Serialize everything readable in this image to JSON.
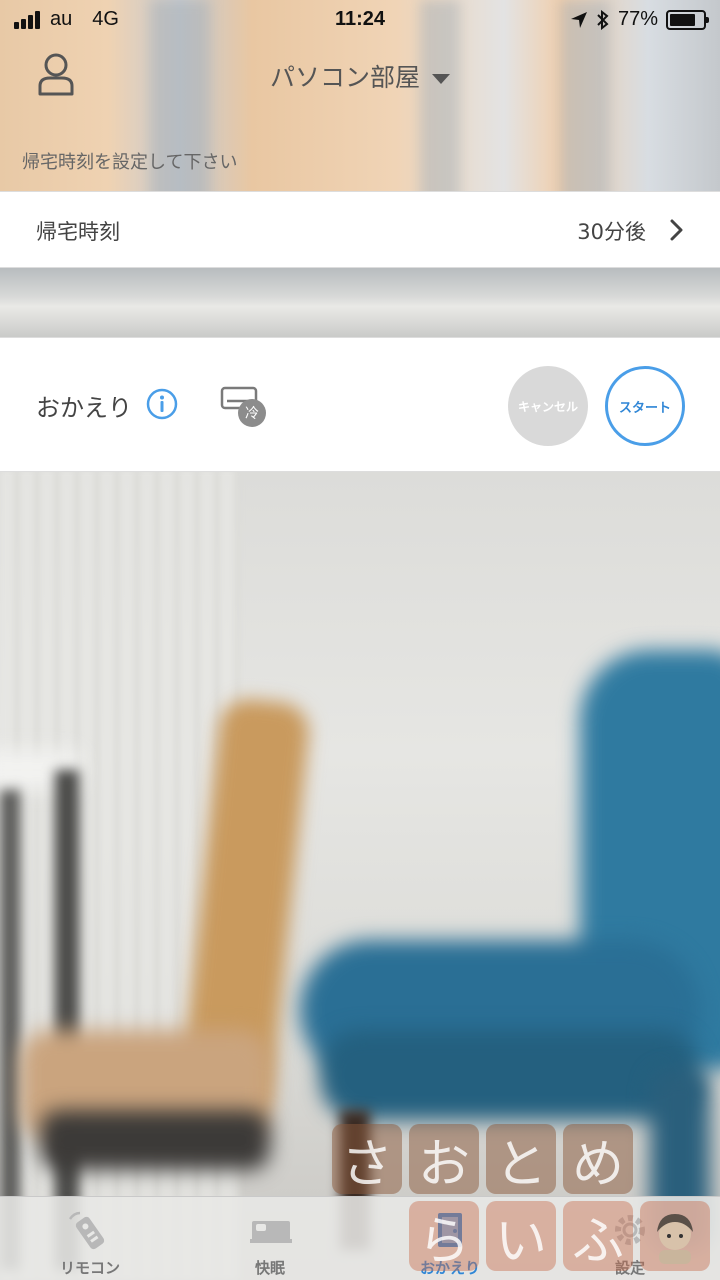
{
  "status_bar": {
    "carrier": "au",
    "network": "4G",
    "time": "11:24",
    "battery_percent": "77%",
    "battery_level": 0.77
  },
  "header": {
    "room_title": "パソコン部屋",
    "hint": "帰宅時刻を設定して下さい"
  },
  "return_time_row": {
    "label": "帰宅時刻",
    "value": "30分後"
  },
  "okaeri_panel": {
    "label": "おかえり",
    "ac_mode_badge": "冷",
    "cancel_label": "キャンセル",
    "start_label": "スタート"
  },
  "tabbar": {
    "tabs": [
      {
        "label": "リモコン",
        "icon": "remote-icon",
        "active": false
      },
      {
        "label": "快眠",
        "icon": "bed-icon",
        "active": false
      },
      {
        "label": "おかえり",
        "icon": "door-icon",
        "active": true
      },
      {
        "label": "設定",
        "icon": "gear-icon",
        "active": false
      }
    ]
  },
  "watermark": {
    "top_chars": [
      "さ",
      "お",
      "と",
      "め"
    ],
    "bottom_chars": [
      "ら",
      "い",
      "ふ"
    ]
  },
  "colors": {
    "accent": "#4a9ee8",
    "cancel_bg": "#d9d9d9",
    "text": "#444444"
  }
}
